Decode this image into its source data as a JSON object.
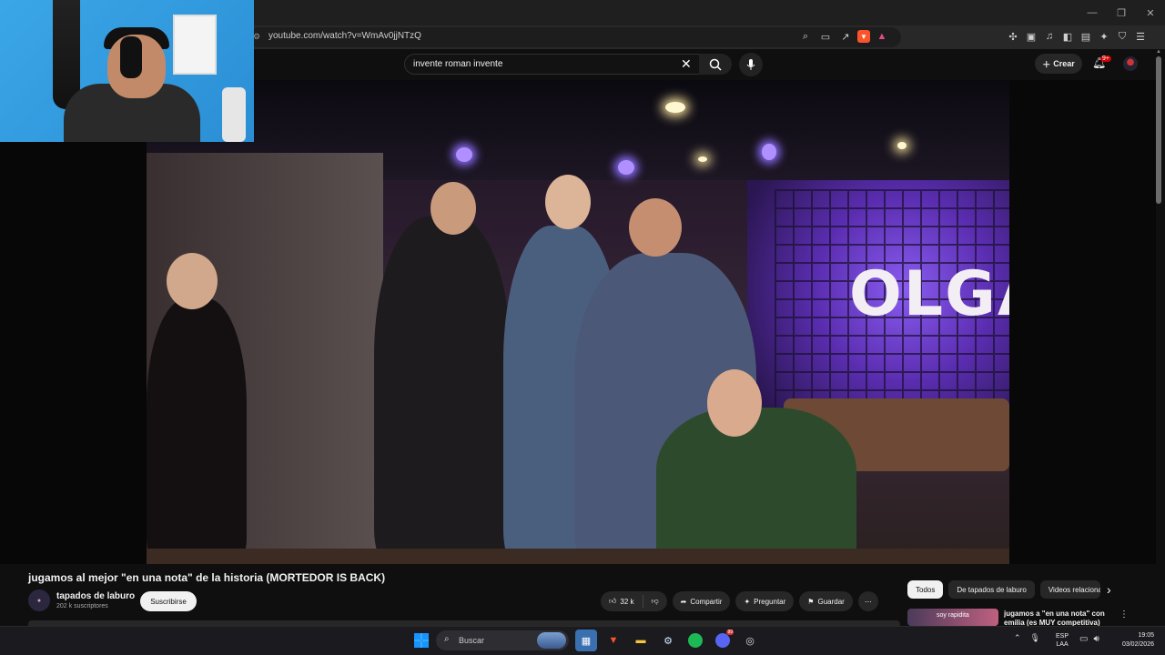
{
  "browser": {
    "url": "youtube.com/watch?v=WmAv0jjNTzQ",
    "window_controls": [
      "—",
      "❐",
      "✕"
    ]
  },
  "youtube": {
    "search_value": "invente roman invente",
    "create_label": "Crear",
    "notifications_badge": "9+"
  },
  "video": {
    "sign_text": "OLGA"
  },
  "details": {
    "title": "jugamos al mejor \"en una nota\" de la historia (MORTEDOR IS BACK)",
    "channel_name": "tapados de laburo",
    "subscribers": "202 k suscriptores",
    "subscribe_label": "Suscribirse",
    "likes": "32 k",
    "share_label": "Compartir",
    "ask_label": "Preguntar",
    "save_label": "Guardar"
  },
  "sidebar": {
    "chips": [
      "Todos",
      "De tapados de laburo",
      "Videos relacionados"
    ],
    "recommended": {
      "thumb_text": "soy rapidita",
      "title": "jugamos a \"en una nota\" con emilia (es MUY competitiva)"
    }
  },
  "taskbar": {
    "search_label": "Buscar",
    "lang_primary": "ESP",
    "lang_secondary": "LAA",
    "time": "19:05",
    "date": "03/02/2026",
    "discord_badge": "99"
  },
  "colors": {
    "background": "#0f0f0f",
    "accent_red": "#cc0000",
    "brave_orange": "#fb542b"
  }
}
